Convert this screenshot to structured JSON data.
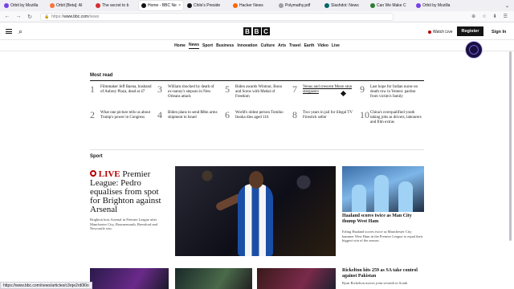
{
  "browser": {
    "tabs": [
      {
        "title": "Orbit by Mozilla",
        "active": false,
        "color": "#7542e5"
      },
      {
        "title": "Orbit [Beta]: AI",
        "active": false,
        "color": "#ff7139"
      },
      {
        "title": "The secret to b",
        "active": false,
        "color": "#d32f2f"
      },
      {
        "title": "Home - BBC Ne",
        "active": true,
        "color": "#141414"
      },
      {
        "title": "Chile's Preside",
        "active": false,
        "color": "#141414"
      },
      {
        "title": "Hacker News",
        "active": false,
        "color": "#ff6600"
      },
      {
        "title": "Polymathy.pdf",
        "active": false,
        "color": "#9e9e9e"
      },
      {
        "title": "Slashdot: News",
        "active": false,
        "color": "#006666"
      },
      {
        "title": "Can We Make C",
        "active": false,
        "color": "#2e7d32"
      },
      {
        "title": "Orbit by Mozilla",
        "active": false,
        "color": "#7542e5"
      }
    ],
    "close_glyph": "×",
    "tab_overflow_glyph": "⌄",
    "back_glyph": "←",
    "forward_glyph": "→",
    "reload_glyph": "↻",
    "url_prefix": "https://",
    "url_host": "www.bbc.com",
    "url_path": "/news",
    "toolbar_glyphs": [
      "⊕",
      "☆",
      "⬇",
      "☰"
    ],
    "status_url": "https://www.bbc.com/news/articles/c3rqe2rd0l0o"
  },
  "header": {
    "logo_letters": [
      "B",
      "B",
      "C"
    ],
    "hamburger_icon": "menu-icon",
    "search_glyph": "⌕",
    "watch_live": "Watch Live",
    "register": "Register",
    "sign_in": "Sign In"
  },
  "nav": {
    "items": [
      "Home",
      "News",
      "Sport",
      "Business",
      "Innovation",
      "Culture",
      "Arts",
      "Travel",
      "Earth",
      "Video",
      "Live"
    ],
    "active_index": 1
  },
  "most_read": {
    "title": "Most read",
    "items": [
      {
        "num": "1",
        "text": "Filmmaker Jeff Baena, husband of Aubrey Plaza, dead at 47"
      },
      {
        "num": "3",
        "text": "William shocked by death of ex-nanny's stepson in New Orleans attack"
      },
      {
        "num": "5",
        "text": "Biden awards Wintour, Bono and Soros with Medal of Freedom"
      },
      {
        "num": "7",
        "text": "Venus and crescent Moon stun stargazers"
      },
      {
        "num": "9",
        "text": "Last hope for Indian nurse on death row in Yemen: pardon from victim's family"
      },
      {
        "num": "2",
        "text": "What one picture tells us about Trump's power in Congress"
      },
      {
        "num": "4",
        "text": "Biden plans to send $8bn arms shipment to Israel"
      },
      {
        "num": "6",
        "text": "World's oldest person Tomiko Itooka dies aged 116"
      },
      {
        "num": "8",
        "text": "Two years in jail for illegal TV Firestick seller"
      },
      {
        "num": "10",
        "text": "China's overqualified youth taking jobs as drivers, labourers and film extras"
      }
    ]
  },
  "sport": {
    "title": "Sport",
    "lead": {
      "live_label": "LIVE",
      "headline": "Premier League: Pedro equalises from spot for Brighton against Arsenal",
      "summary": "Brighton host Arsenal in Premier League after Manchester City, Bournemouth, Brentford and Newcastle win."
    },
    "side": {
      "headline": "Haaland scores twice as Man City thump West Ham",
      "summary": "Erling Haaland scores twice as Manchester City hammer West Ham in the Premier League to equal their biggest win of the season."
    },
    "bottom": {
      "headline": "Rickelton hits 259 as SA take control against Pakistan",
      "summary": "Ryan Rickelton moves joint seventh in South"
    }
  }
}
